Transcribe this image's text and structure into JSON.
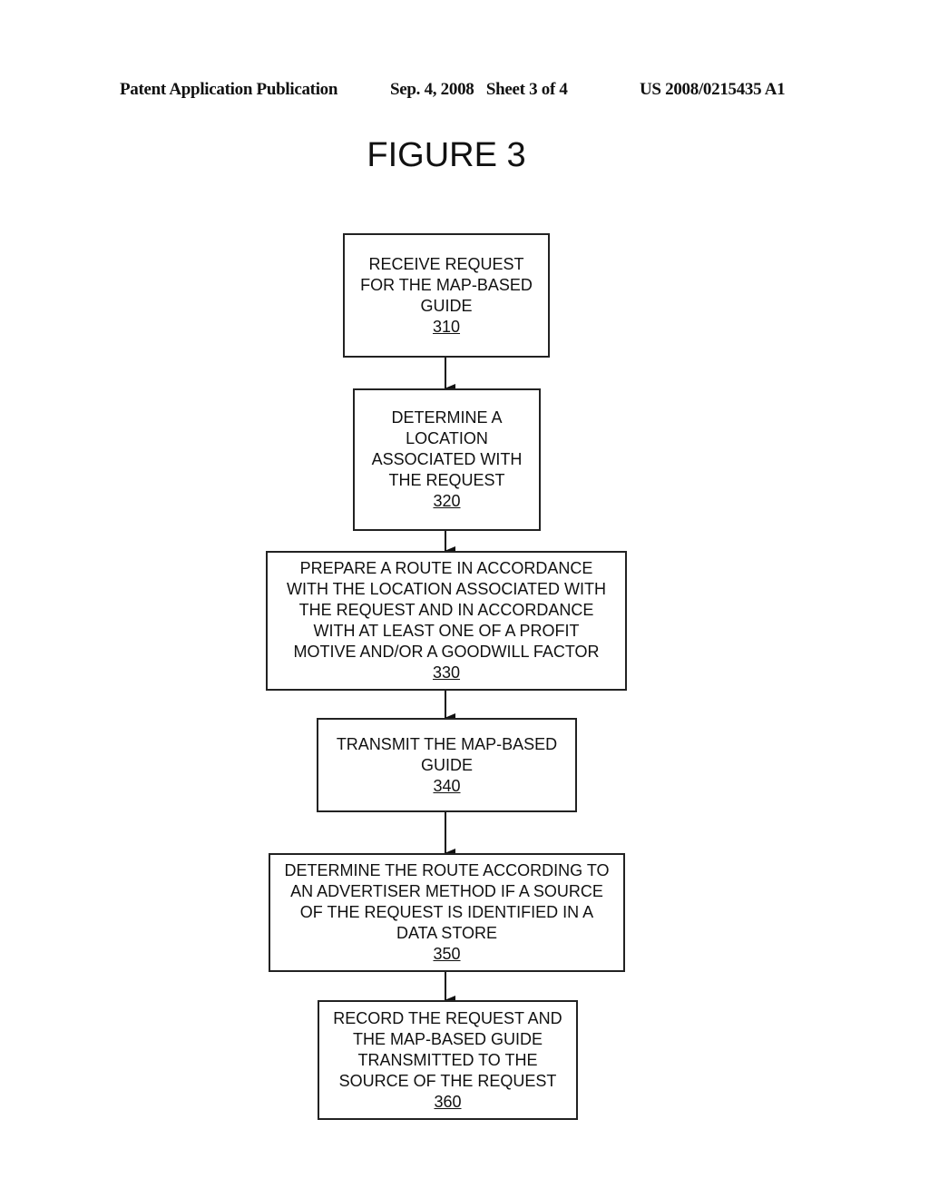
{
  "header": {
    "left": "Patent Application Publication",
    "middle": "Sep. 4, 2008   Sheet 3 of 4",
    "right": "US 2008/0215435 A1"
  },
  "figure_title": "FIGURE 3",
  "flowchart": {
    "steps": [
      {
        "text": "RECEIVE REQUEST\nFOR THE MAP-BASED\nGUIDE",
        "ref": "310"
      },
      {
        "text": "DETERMINE A\nLOCATION\nASSOCIATED WITH\nTHE REQUEST",
        "ref": "320"
      },
      {
        "text": "PREPARE A ROUTE IN ACCORDANCE\nWITH THE LOCATION ASSOCIATED WITH\nTHE REQUEST AND IN ACCORDANCE\nWITH AT LEAST ONE OF A PROFIT\nMOTIVE AND/OR A GOODWILL FACTOR",
        "ref": "330"
      },
      {
        "text": "TRANSMIT THE MAP-BASED\nGUIDE",
        "ref": "340"
      },
      {
        "text": "DETERMINE THE ROUTE ACCORDING TO\nAN ADVERTISER METHOD IF A SOURCE\nOF THE REQUEST IS IDENTIFIED IN A\nDATA STORE",
        "ref": "350"
      },
      {
        "text": "RECORD THE REQUEST AND\nTHE MAP-BASED GUIDE\nTRANSMITTED TO THE\nSOURCE OF THE REQUEST",
        "ref": "360"
      }
    ],
    "edges": [
      {
        "from": "310",
        "to": "320"
      },
      {
        "from": "320",
        "to": "330"
      },
      {
        "from": "330",
        "to": "340"
      },
      {
        "from": "340",
        "to": "350"
      },
      {
        "from": "350",
        "to": "360"
      }
    ]
  }
}
